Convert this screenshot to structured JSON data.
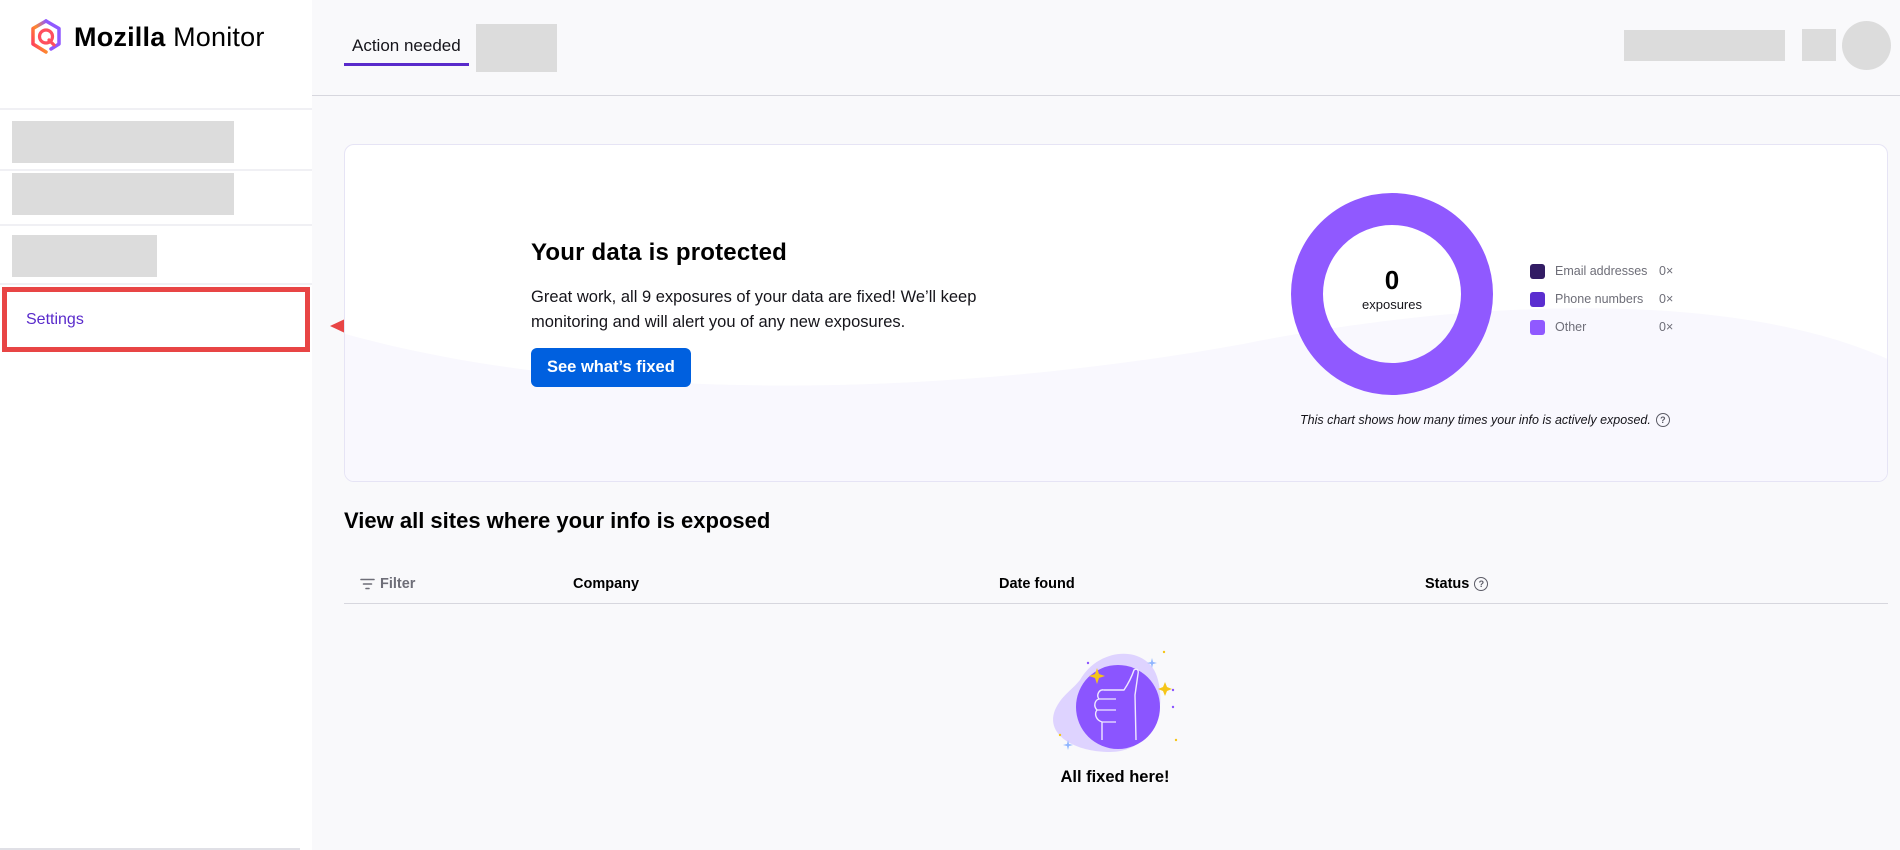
{
  "app": {
    "brand_bold": "Mozilla",
    "brand_regular": "Monitor",
    "logo_icon": "mozilla-monitor-logo-icon"
  },
  "sidebar": {
    "items": [
      {
        "label": "Settings",
        "active": true,
        "highlighted": true
      }
    ]
  },
  "annotation": {
    "arrow_icon": "left-arrow-icon",
    "arrow_color": "#e84545",
    "highlight_color": "#e84545"
  },
  "topbar": {
    "tabs": [
      {
        "label": "Action needed",
        "active": true
      }
    ],
    "accent_color": "#592acb"
  },
  "hero": {
    "title": "Your data is protected",
    "description": "Great work, all 9 exposures of your data are fixed! We’ll keep monitoring and will alert you of any new exposures.",
    "button_label": "See what’s fixed",
    "button_color": "#0060df"
  },
  "chart_data": {
    "type": "pie",
    "title": "",
    "center_value": "0",
    "center_label": "exposures",
    "categories": [
      "Email addresses",
      "Phone numbers",
      "Other"
    ],
    "values": [
      0,
      0,
      0
    ],
    "value_labels": [
      "0×",
      "0×",
      "0×"
    ],
    "colors": [
      "#321c64",
      "#5b2ed0",
      "#9059ff"
    ],
    "empty_ring_color": "#9059ff",
    "legend_position": "right",
    "note": "This chart shows how many times your info is actively exposed."
  },
  "exposures": {
    "title": "View all sites where your info is exposed",
    "filter_label": "Filter",
    "columns": [
      "Company",
      "Date found",
      "Status"
    ],
    "rows": [],
    "empty_message": "All fixed here!"
  }
}
